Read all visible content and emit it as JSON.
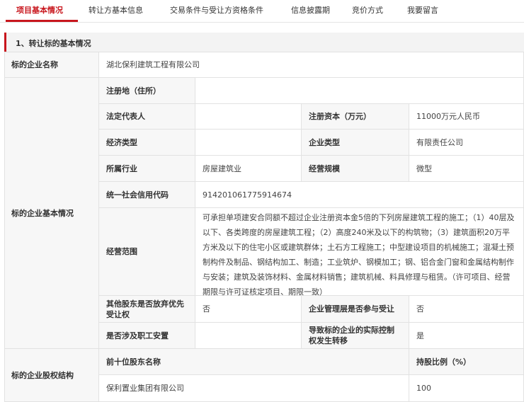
{
  "tabs": [
    "项目基本情况",
    "转让方基本信息",
    "交易条件与受让方资格条件",
    "信息披露期",
    "竞价方式",
    "我要留言"
  ],
  "section_title": "1、转让标的基本情况",
  "company": {
    "name_label": "标的企业名称",
    "name_value": "湖北保利建筑工程有限公司"
  },
  "basic": {
    "group_label": "标的企业基本情况",
    "reg_addr_label": "注册地（住所）",
    "reg_addr_value": "",
    "legal_rep_label": "法定代表人",
    "legal_rep_value": "",
    "reg_capital_label": "注册资本（万元）",
    "reg_capital_value": "11000万元人民币",
    "econ_type_label": "经济类型",
    "econ_type_value": "",
    "corp_type_label": "企业类型",
    "corp_type_value": "有限责任公司",
    "industry_label": "所属行业",
    "industry_value": "房屋建筑业",
    "scale_label": "经营规模",
    "scale_value": "微型",
    "credit_code_label": "统一社会信用代码",
    "credit_code_value": "914201061775914674",
    "scope_label": "经营范围",
    "scope_value": "可承担单项建安合同额不超过企业注册资本金5倍的下列房屋建筑工程的施工；（1）40层及以下、各类跨度的房屋建筑工程；（2）高度240米及以下的构筑物；（3）建筑面积20万平方米及以下的住宅小区或建筑群体；土石方工程施工；中型建设项目的机械施工；混凝土预制构件及制品、钢结构加工、制造；工业筑炉、钢模加工；钢、铝合金门窗和金属结构制作与安装；建筑及装饰材料、金属材料销售；建筑机械、料具修理与租赁。（许可项目、经营期限与许可证核定项目、期限一致）",
    "waive_label": "其他股东是否放弃优先受让权",
    "waive_value": "否",
    "mgmt_label": "企业管理层是否参与受让",
    "mgmt_value": "否",
    "staff_label": "是否涉及职工安置",
    "staff_value": "",
    "control_label": "导致标的企业的实际控制权发生转移",
    "control_value": "是"
  },
  "equity": {
    "group_label": "标的企业股权结构",
    "top10_label": "前十位股东名称",
    "ratio_label": "持股比例（%）",
    "rows": [
      {
        "name": "保利置业集团有限公司",
        "ratio": "100"
      }
    ]
  }
}
